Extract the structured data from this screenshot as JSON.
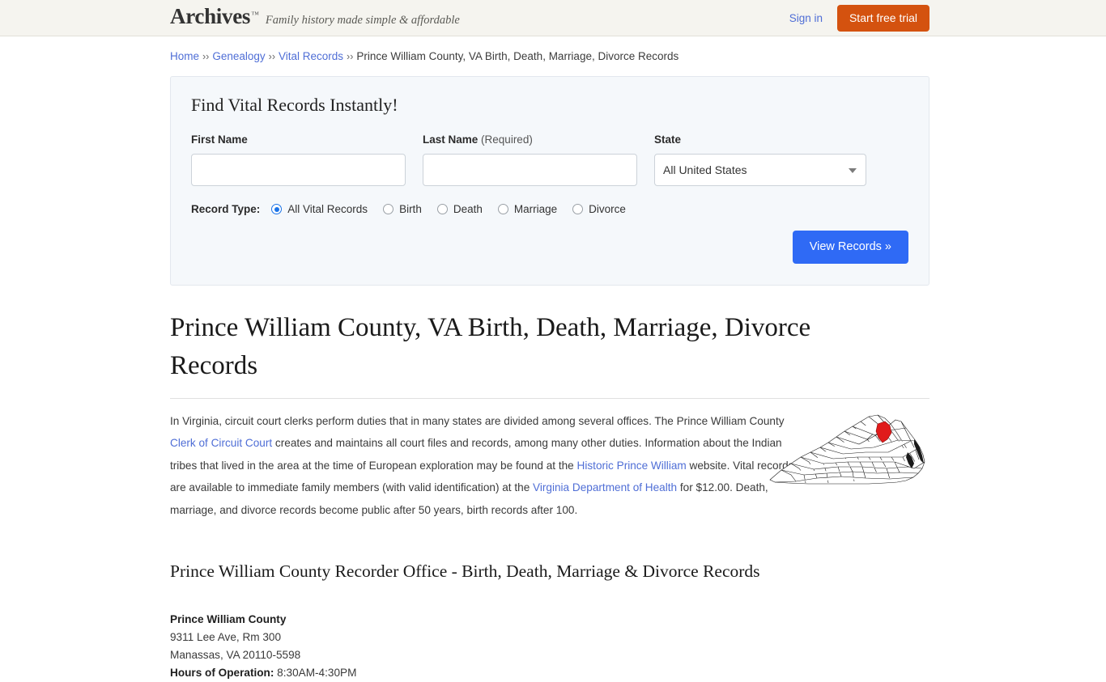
{
  "header": {
    "logo_text": "Archives",
    "logo_tm": "™",
    "tagline": "Family history made simple & affordable",
    "signin_label": "Sign in",
    "trial_label": "Start free trial",
    "background_color": "#f5f4ef",
    "trial_button_color": "#d4520f",
    "link_color": "#4f6ed6"
  },
  "breadcrumb": {
    "separator": "››",
    "items": [
      {
        "label": "Home",
        "is_link": true
      },
      {
        "label": "Genealogy",
        "is_link": true
      },
      {
        "label": "Vital Records",
        "is_link": true
      },
      {
        "label": "Prince William County, VA Birth, Death, Marriage, Divorce Records",
        "is_link": false
      }
    ]
  },
  "search_panel": {
    "title": "Find Vital Records Instantly!",
    "first_name": {
      "label": "First Name",
      "value": "",
      "placeholder": ""
    },
    "last_name": {
      "label": "Last Name",
      "required_note": "(Required)",
      "value": "",
      "placeholder": ""
    },
    "state": {
      "label": "State",
      "selected": "All United States",
      "caret_icon": "chevron-down-icon"
    },
    "record_type": {
      "label": "Record Type:",
      "selected": "All Vital Records",
      "options": [
        "All Vital Records",
        "Birth",
        "Death",
        "Marriage",
        "Divorce"
      ]
    },
    "submit_label": "View Records »",
    "submit_color": "#2f6af5",
    "panel_background": "#f5f8fb"
  },
  "page_title": "Prince William County, VA Birth, Death, Marriage, Divorce Records",
  "intro": {
    "part1": "In Virginia, circuit court clerks perform duties that in many states are divided among several offices. The Prince William County ",
    "link1": "Clerk of Circuit Court",
    "part2": " creates and maintains all court files and records, among many other duties. Information about the Indian tribes that lived in the area at the time of European exploration may be found at the ",
    "link2": "Historic Prince William",
    "part3": " website. Vital records are available to immediate family members (with valid identification) at the ",
    "link3": "Virginia Department of Health",
    "part4": " for $12.00. Death, marriage, and divorce records become public after 50 years, birth records after 100."
  },
  "map": {
    "alt": "Map of Virginia with Prince William County highlighted",
    "highlight_color": "#e01b1b",
    "outline_color": "#1a1a1a"
  },
  "section_title": "Prince William County Recorder Office - Birth, Death, Marriage & Divorce Records",
  "office": {
    "name": "Prince William County",
    "address_line1": "9311 Lee Ave, Rm 300",
    "address_line2": "Manassas, VA 20110-5598",
    "hours_label": "Hours of Operation:",
    "hours_value": "8:30AM-4:30PM"
  }
}
